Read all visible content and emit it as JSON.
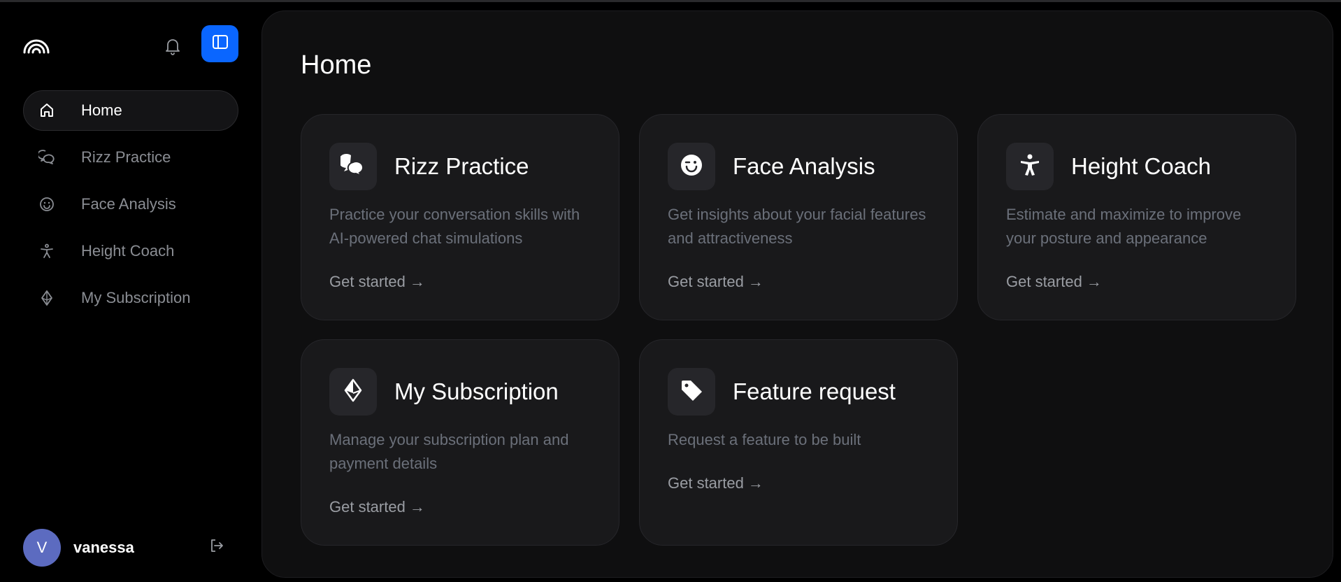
{
  "sidebar": {
    "nav": [
      {
        "label": "Home",
        "icon": "home-icon",
        "active": true
      },
      {
        "label": "Rizz Practice",
        "icon": "chat-bubbles-icon",
        "active": false
      },
      {
        "label": "Face Analysis",
        "icon": "smiley-icon",
        "active": false
      },
      {
        "label": "Height Coach",
        "icon": "accessibility-person-icon",
        "active": false
      },
      {
        "label": "My Subscription",
        "icon": "diamond-icon",
        "active": false
      }
    ],
    "user": {
      "initial": "V",
      "name": "vanessa"
    }
  },
  "main": {
    "title": "Home",
    "cards": [
      {
        "title": "Rizz Practice",
        "description": "Practice your conversation skills with AI-powered chat simulations",
        "cta": "Get started",
        "icon": "chat-bubbles-icon"
      },
      {
        "title": "Face Analysis",
        "description": "Get insights about your facial features and attractiveness",
        "cta": "Get started",
        "icon": "winking-face-icon"
      },
      {
        "title": "Height Coach",
        "description": "Estimate and maximize to improve your posture and appearance",
        "cta": "Get started",
        "icon": "accessibility-person-icon"
      },
      {
        "title": "My Subscription",
        "description": "Manage your subscription plan and payment details",
        "cta": "Get started",
        "icon": "diamond-icon"
      },
      {
        "title": "Feature request",
        "description": "Request a feature to be built",
        "cta": "Get started",
        "icon": "tag-icon"
      }
    ]
  },
  "colors": {
    "accent": "#0a66ff",
    "background": "#000000",
    "panel": "#0f0f10",
    "card": "#19191b",
    "muted_text": "#6b707a",
    "avatar": "#5c6bc0"
  }
}
